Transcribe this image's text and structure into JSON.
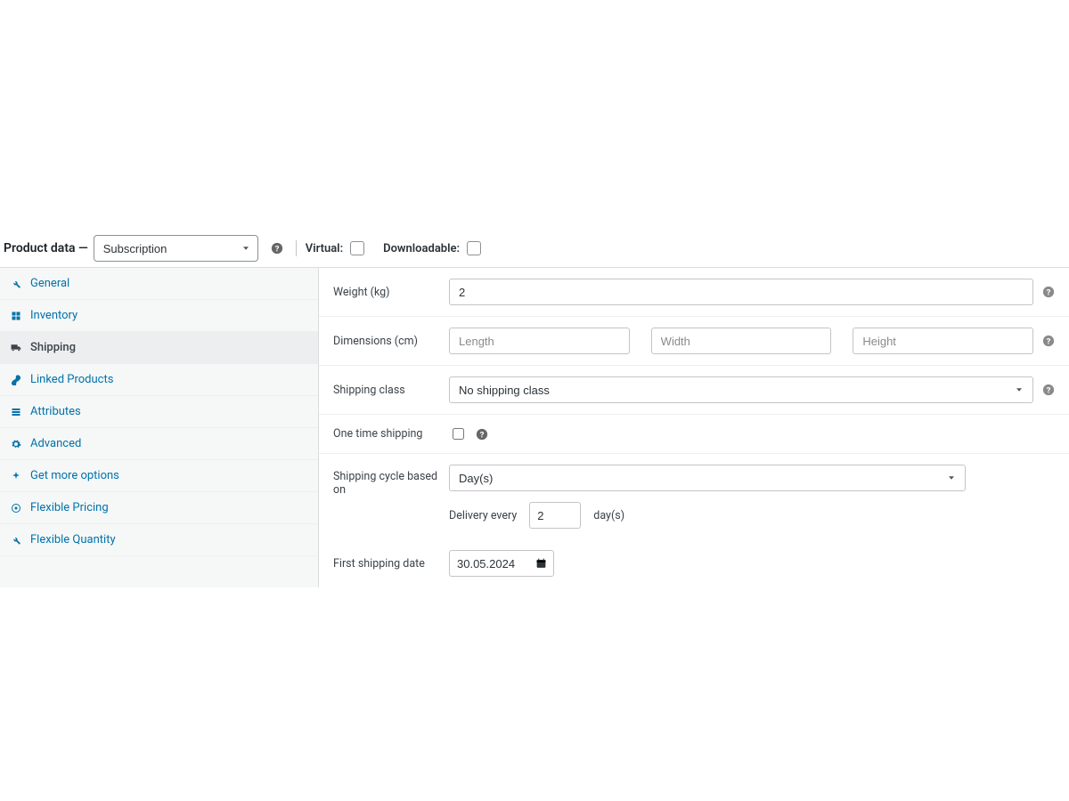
{
  "header": {
    "title": "Product data —",
    "product_type": "Subscription",
    "virtual_label": "Virtual:",
    "downloadable_label": "Downloadable:"
  },
  "tabs": {
    "general": "General",
    "inventory": "Inventory",
    "shipping": "Shipping",
    "linked": "Linked Products",
    "attributes": "Attributes",
    "advanced": "Advanced",
    "get_more": "Get more options",
    "flex_pricing": "Flexible Pricing",
    "flex_qty": "Flexible Quantity"
  },
  "fields": {
    "weight_label": "Weight (kg)",
    "weight_value": "2",
    "dimensions_label": "Dimensions (cm)",
    "length_ph": "Length",
    "width_ph": "Width",
    "height_ph": "Height",
    "shipping_class_label": "Shipping class",
    "shipping_class_value": "No shipping class",
    "one_time_label": "One time shipping",
    "cycle_label": "Shipping cycle based on",
    "cycle_value": "Day(s)",
    "delivery_every_label": "Delivery every",
    "delivery_every_value": "2",
    "delivery_unit": "day(s)",
    "first_date_label": "First shipping date",
    "first_date_value": "30.05.2024"
  }
}
